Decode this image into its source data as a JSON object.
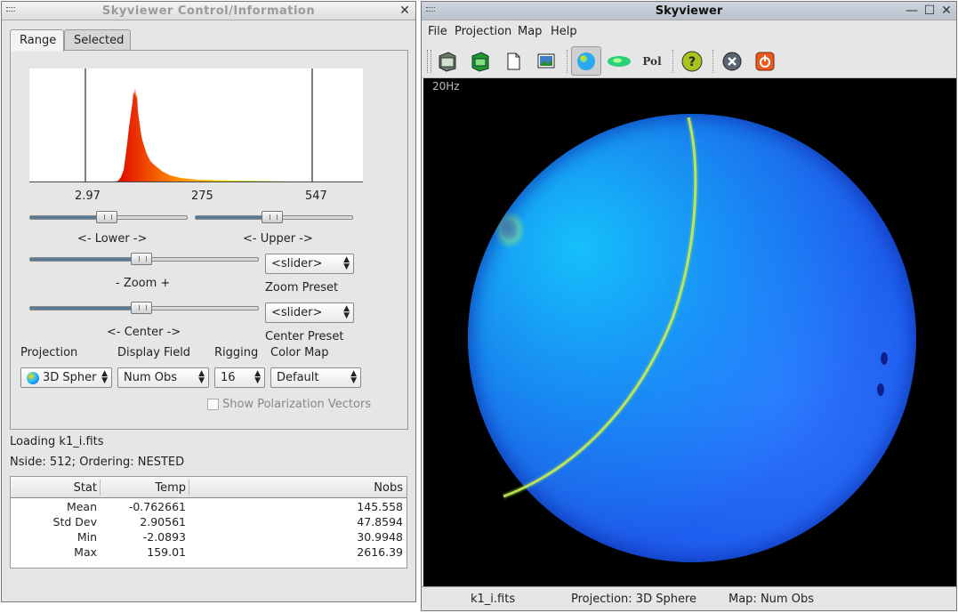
{
  "control_window": {
    "title": "Skyviewer Control/Information",
    "tabs": [
      {
        "label": "Range",
        "active": true
      },
      {
        "label": "Selected",
        "active": false
      }
    ],
    "range": {
      "hist_ticks": [
        "2.97",
        "275",
        "547"
      ],
      "lower_label": "<- Lower ->",
      "upper_label": "<- Upper ->",
      "lower_slider": 0.5,
      "upper_slider": 0.5,
      "zoom_label": "-  Zoom  +",
      "zoom_slider": 0.5,
      "zoom_preset_value": "<slider>",
      "zoom_preset_label": "Zoom Preset",
      "center_label": "<-  Center  ->",
      "center_slider": 0.5,
      "center_preset_value": "<slider>",
      "center_preset_label": "Center Preset",
      "projection_label": "Projection",
      "projection_value": "3D Spher",
      "display_field_label": "Display Field",
      "display_field_value": "Num Obs",
      "rigging_label": "Rigging",
      "rigging_value": "16",
      "colormap_label": "Color Map",
      "colormap_value": "Default",
      "polarization_label": "Show Polarization Vectors",
      "polarization_checked": false
    },
    "loading_text": "Loading  k1_i.fits",
    "nside_text": "Nside:  512;  Ordering:  NESTED",
    "stats_table": {
      "columns": [
        "Stat",
        "Temp",
        "Nobs"
      ],
      "rows": [
        [
          "Mean",
          "-0.762661",
          "145.558"
        ],
        [
          "Std Dev",
          "2.90561",
          "47.8594"
        ],
        [
          "Min",
          "-2.0893",
          "30.9948"
        ],
        [
          "Max",
          "159.01",
          "2616.39"
        ]
      ]
    }
  },
  "sky_window": {
    "title": "Skyviewer",
    "menu": [
      "File",
      "Projection",
      "Map",
      "Help"
    ],
    "toolbar": [
      "open-icon",
      "open-green-icon",
      "new-document-icon",
      "screenshot-icon",
      "sphere-view-icon",
      "ellipse-view-icon",
      "polarization-icon",
      "help-icon",
      "close-map-icon",
      "quit-icon"
    ],
    "toolbar_pol_label": "Pol",
    "band_label": "20Hz",
    "status": {
      "file": "k1_i.fits",
      "projection": "Projection: 3D Sphere",
      "map": "Map: Num Obs"
    }
  },
  "colors": {
    "accent": "#587a96",
    "map_background": "#000000"
  }
}
